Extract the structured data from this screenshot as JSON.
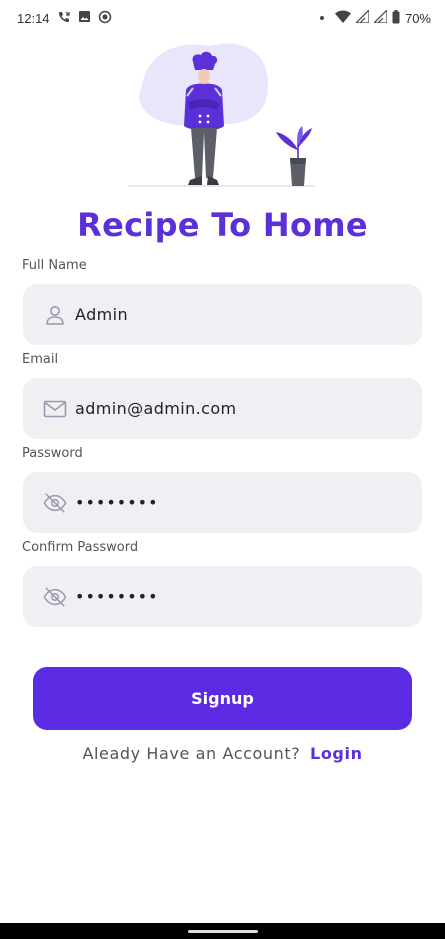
{
  "status_bar": {
    "time": "12:14",
    "battery": "70%",
    "icons": [
      "missed-call-icon",
      "image-icon",
      "media-icon",
      "dot-icon",
      "wifi-icon",
      "signal-icon",
      "signal-icon",
      "battery-icon"
    ]
  },
  "app": {
    "title": "Recipe To Home",
    "accent_color": "#5b2be3"
  },
  "form": {
    "full_name": {
      "label": "Full Name",
      "value": "Admin",
      "icon": "user-icon"
    },
    "email": {
      "label": "Email",
      "value": "admin@admin.com",
      "icon": "mail-icon"
    },
    "password": {
      "label": "Password",
      "value": "••••••••",
      "icon": "eye-off-icon"
    },
    "confirm_password": {
      "label": "Confirm Password",
      "value": "••••••••",
      "icon": "eye-off-icon"
    }
  },
  "signup_button": {
    "label": "Signup"
  },
  "login_prompt": {
    "text": "Aleady Have an Account?",
    "link": "Login"
  }
}
